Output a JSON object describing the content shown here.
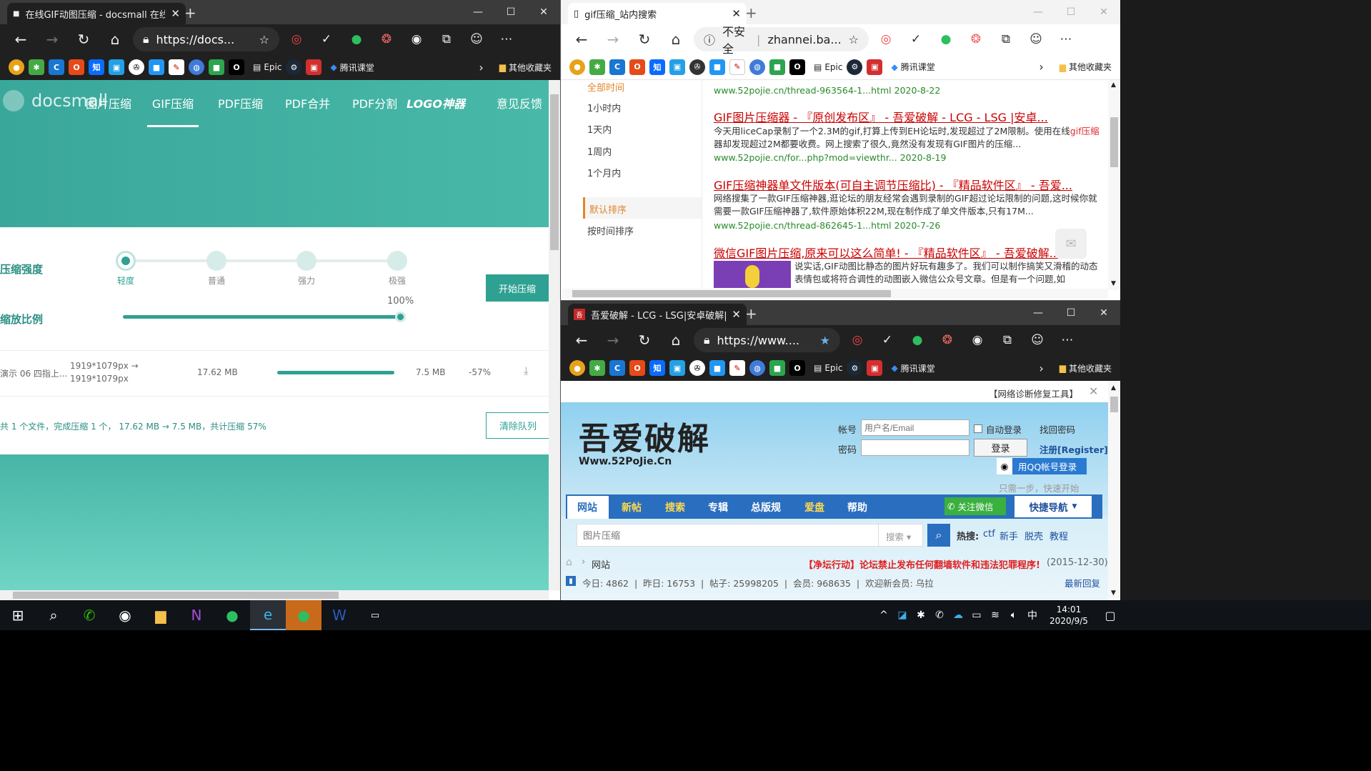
{
  "left_window": {
    "tab_title": "在线GIF动图压缩 - docsmall 在线",
    "url": "https://docs...",
    "logo_text": "docsmall",
    "nav": [
      "图片压缩",
      "GIF压缩",
      "PDF压缩",
      "PDF合并",
      "PDF分割",
      "LOGO神器",
      "意见反馈"
    ],
    "compress_strength_label": "压缩强度",
    "levels": [
      "轻度",
      "普通",
      "强力",
      "极强"
    ],
    "scale_label": "缩放比例",
    "scale_value": "100%",
    "start_button": "开始压缩",
    "file_row": {
      "name": "演示 06 四指上...",
      "dims_from": "1919*1079px →",
      "dims_to": "1919*1079px",
      "orig_size": "17.62 MB",
      "new_size": "7.5 MB",
      "ratio": "-57%",
      "progress": 1.0
    },
    "summary": "共 1 个文件，完成压缩 1 个， 17.62 MB → 7.5 MB，共计压缩 57%",
    "clear_button": "清除队列"
  },
  "favorites": [
    "Epic",
    "腾讯课堂",
    "其他收藏夹"
  ],
  "top_right_window": {
    "tab_title": "gif压缩_站内搜索",
    "security": "不安全",
    "url": "zhannei.ba...",
    "sidebar": [
      "全部时间",
      "1小时内",
      "1天内",
      "1周内",
      "1个月内",
      "默认排序",
      "按时间排序"
    ],
    "results": [
      {
        "url_line": "www.52pojie.cn/thread-963564-1...html 2020-8-22"
      },
      {
        "title": "GIF图片压缩器 - 『原创发布区』 - 吾爱破解 - LCG - LSG |安卓...",
        "body_pre": "今天用liceCap录制了一个2.3M的gif,打算上传到EH论坛时,发现超过了2M限制。使用在线",
        "body_hl": "gif压缩",
        "body_post": "器却发现超过2M都要收费。网上搜索了很久,竟然没有发现有GIF图片的压缩...",
        "url_line": "www.52pojie.cn/for...php?mod=viewthr... 2020-8-19"
      },
      {
        "title": "GIF压缩神器单文件版本(可自主调节压缩比) - 『精品软件区』 - 吾爱...",
        "body": "网络搜集了一款GIF压缩神器,逛论坛的朋友经常会遇到录制的GIF超过论坛限制的问题,这时候你就需要一款GIF压缩神器了,软件原始体积22M,现在制作成了单文件版本,只有17M...",
        "url_line": "www.52pojie.cn/thread-862645-1...html 2020-7-26"
      },
      {
        "title": "微信GIF图片压缩,原来可以这么简单! - 『精品软件区』 - 吾爱破解...",
        "body": "说实话,GIF动图比静态的图片好玩有趣多了。我们可以制作搞笑又滑稽的动态表情包或将符合调性的动图嵌入微信公众号文章。但是有一个问题,如"
      }
    ]
  },
  "bottom_right_window": {
    "tab_title": "吾爱破解 - LCG - LSG|安卓破解|",
    "url": "https://www....",
    "diag_link": "【网络诊断修复工具】",
    "logo_text": "吾爱破解",
    "logo_sub": "Www.52PoJie.Cn",
    "account_label": "帐号",
    "account_placeholder": "用户名/Email",
    "auto_login": "自动登录",
    "find_password": "找回密码",
    "password_label": "密码",
    "login_button": "登录",
    "register": "注册[Register]",
    "qq_login": "用QQ帐号登录",
    "tagline": "只需一步，快速开始",
    "nav": [
      "网站",
      "新帖",
      "搜索",
      "专辑",
      "总版规",
      "爱盘",
      "帮助"
    ],
    "wechat": "关注微信",
    "quick_nav": "快捷导航",
    "search_placeholder": "图片压缩",
    "search_type": "搜索",
    "hot_label": "热搜:",
    "hot_words": [
      "ctf",
      "新手",
      "脱壳",
      "教程"
    ],
    "breadcrumb": "网站",
    "notice": "【净坛行动】论坛禁止发布任何翻墙软件和违法犯罪程序!",
    "notice_date": "(2015-12-30)",
    "stats": "今日: 4862  |  昨日: 16753  |  帖子: 25998205  |  会员: 968635  |  欢迎新会员: 乌拉",
    "latest_reply": "最新回复"
  },
  "taskbar": {
    "time": "14:01",
    "date": "2020/9/5",
    "ime": "中"
  }
}
